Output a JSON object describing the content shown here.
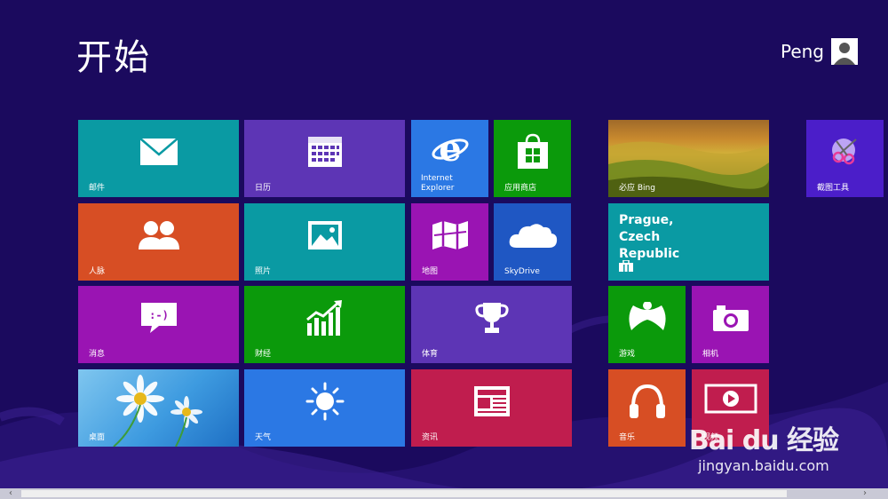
{
  "screen": {
    "title": "开始",
    "user": "Peng"
  },
  "tiles": {
    "mail": "邮件",
    "calendar": "日历",
    "ie": "Internet\nExplorer",
    "store": "应用商店",
    "bing": "必应 Bing",
    "snip": "截图工具",
    "people": "人脉",
    "photos": "照片",
    "maps": "地图",
    "skydrive": "SkyDrive",
    "weather_city": "Prague, Czech Republic",
    "messaging": "消息",
    "finance": "财经",
    "sports": "体育",
    "games": "游戏",
    "camera": "相机",
    "desktop": "桌面",
    "weather": "天气",
    "news": "资讯",
    "music": "音乐",
    "video": "视频"
  },
  "watermark": {
    "logo": "Bai du 经验",
    "url": "jingyan.baidu.com"
  },
  "colors": {
    "background": "#1b0a5e",
    "teal": "#0a9aa3",
    "purple": "#5d35b5",
    "blue": "#2b78e4",
    "green": "#0b9a0b",
    "orange": "#d74e24",
    "magenta": "#8c16a6",
    "red": "#c01d4e"
  }
}
